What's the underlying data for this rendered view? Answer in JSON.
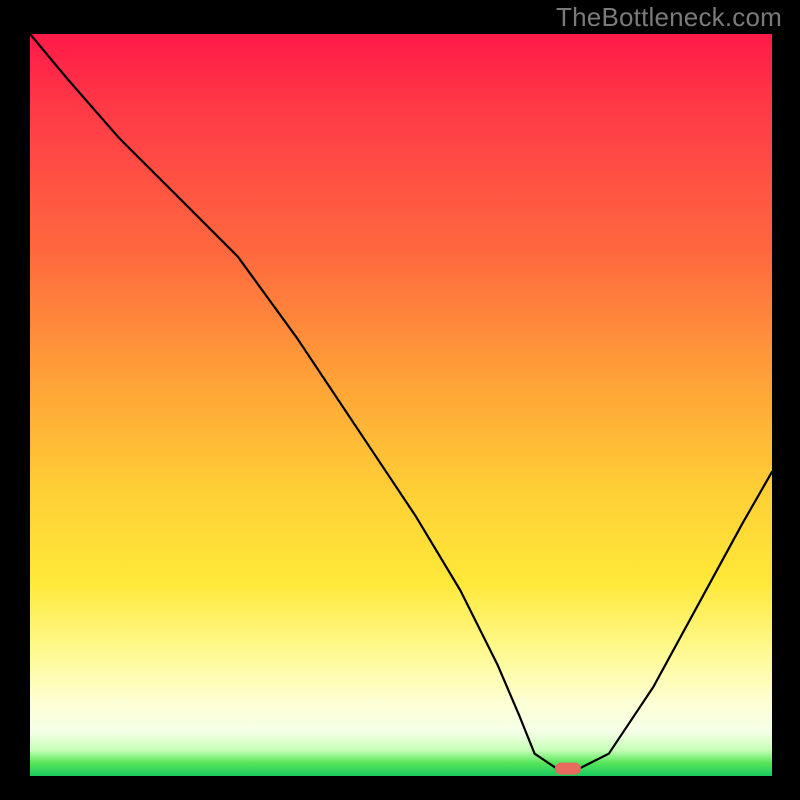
{
  "watermark": "TheBottleneck.com",
  "chart_data": {
    "type": "line",
    "title": "",
    "xlabel": "",
    "ylabel": "",
    "xlim": [
      0,
      100
    ],
    "ylim": [
      0,
      100
    ],
    "grid": false,
    "axes_visible": false,
    "legend": false,
    "background_gradient": {
      "direction": "vertical",
      "stops": [
        {
          "pos": 0,
          "color": "#ff1a47"
        },
        {
          "pos": 30,
          "color": "#ff6a3e"
        },
        {
          "pos": 60,
          "color": "#ffd036"
        },
        {
          "pos": 85,
          "color": "#fff98f"
        },
        {
          "pos": 96,
          "color": "#c6ffb7"
        },
        {
          "pos": 100,
          "color": "#18c95c"
        }
      ]
    },
    "series": [
      {
        "name": "bottleneck-curve",
        "x": [
          0,
          5,
          12,
          20,
          28,
          36,
          44,
          52,
          58,
          63,
          66,
          68,
          71,
          74,
          78,
          84,
          90,
          96,
          100
        ],
        "y": [
          100,
          94,
          86,
          78,
          70,
          59,
          47,
          35,
          25,
          15,
          8,
          3,
          1,
          1,
          3,
          12,
          23,
          34,
          41
        ]
      }
    ],
    "marker": {
      "name": "optimal-point",
      "x": 72.5,
      "y": 1,
      "shape": "rounded-rect",
      "color": "#e8695e"
    }
  }
}
